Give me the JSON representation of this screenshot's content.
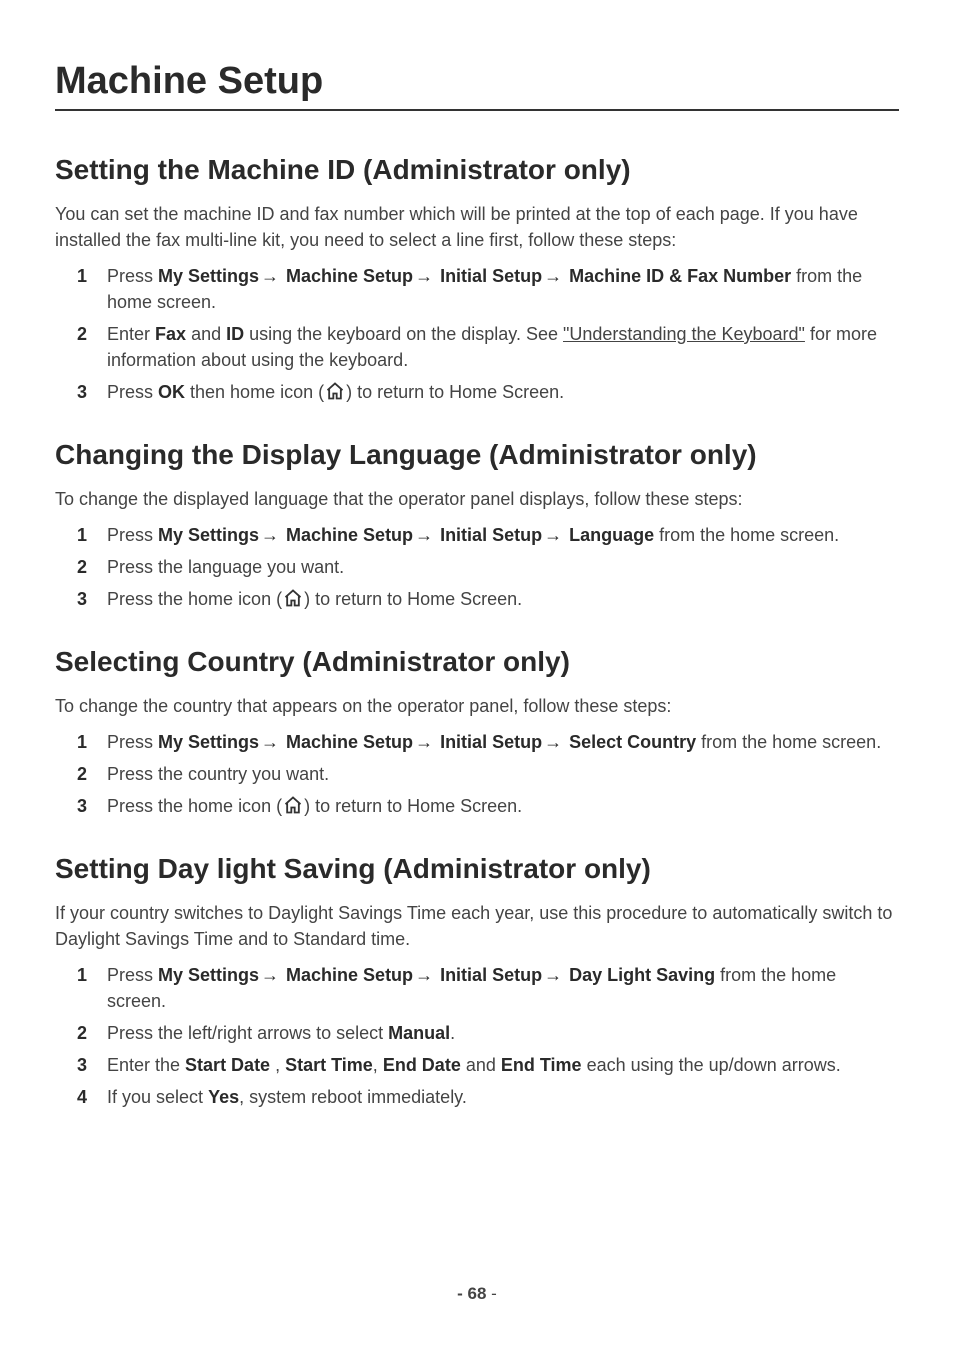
{
  "page": {
    "title": "Machine Setup",
    "page_number_prefix": "- ",
    "page_number": "68",
    "page_number_suffix": " -"
  },
  "sections": {
    "machine_id": {
      "heading": "Setting the Machine ID (Administrator only)",
      "intro": "You can set the machine ID and fax number which will be printed at the top of each page. If you have installed the fax multi-line kit, you need to select a line first, follow these steps:",
      "step1_a": "Press ",
      "step1_b": "My Settings",
      "step1_c": " Machine Setup",
      "step1_d": " Initial Setup",
      "step1_e": " Machine ID & Fax Number",
      "step1_f": " from the home screen.",
      "step2_a": "Enter ",
      "step2_b": "Fax",
      "step2_c": " and ",
      "step2_d": "ID",
      "step2_e": " using the keyboard on the display. See ",
      "step2_f": "\"Understanding the Keyboard\"",
      "step2_g": " for more information about using the keyboard.",
      "step3_a": "Press ",
      "step3_b": "OK",
      "step3_c": " then home icon (",
      "step3_d": ") to return to Home Screen."
    },
    "language": {
      "heading": "Changing the Display Language (Administrator only)",
      "intro": "To change the displayed language that the operator panel displays, follow these steps:",
      "step1_a": "Press ",
      "step1_b": "My Settings",
      "step1_c": " Machine Setup",
      "step1_d": " Initial Setup",
      "step1_e": " Language",
      "step1_f": " from the home screen.",
      "step2": "Press the language you want.",
      "step3_a": "Press the home icon (",
      "step3_b": ") to return to Home Screen."
    },
    "country": {
      "heading": "Selecting Country (Administrator only)",
      "intro": "To change the country that appears on the operator panel, follow these steps:",
      "step1_a": "Press ",
      "step1_b": "My Settings",
      "step1_c": " Machine Setup",
      "step1_d": " Initial Setup",
      "step1_e": " Select Country",
      "step1_f": " from the home screen.",
      "step2": "Press the country you want.",
      "step3_a": "Press the home icon (",
      "step3_b": ") to return to Home Screen."
    },
    "daylight": {
      "heading": "Setting Day light Saving (Administrator only)",
      "intro": "If your country switches to Daylight Savings Time each year, use this procedure to automatically switch to Daylight Savings Time and to Standard time.",
      "step1_a": "Press ",
      "step1_b": "My Settings",
      "step1_c": " Machine Setup",
      "step1_d": " Initial Setup",
      "step1_e": " Day Light Saving",
      "step1_f": " from the home screen.",
      "step2_a": "Press the left/right arrows to select ",
      "step2_b": "Manual",
      "step2_c": ".",
      "step3_a": "Enter the ",
      "step3_b": "Start Date",
      "step3_c": " , ",
      "step3_d": "Start Time",
      "step3_e": ", ",
      "step3_f": "End Date",
      "step3_g": " and ",
      "step3_h": "End Time",
      "step3_i": " each using the up/down arrows.",
      "step4_a": "If you select ",
      "step4_b": "Yes",
      "step4_c": ", system reboot immediately."
    }
  },
  "glyphs": {
    "arrow": "→"
  }
}
